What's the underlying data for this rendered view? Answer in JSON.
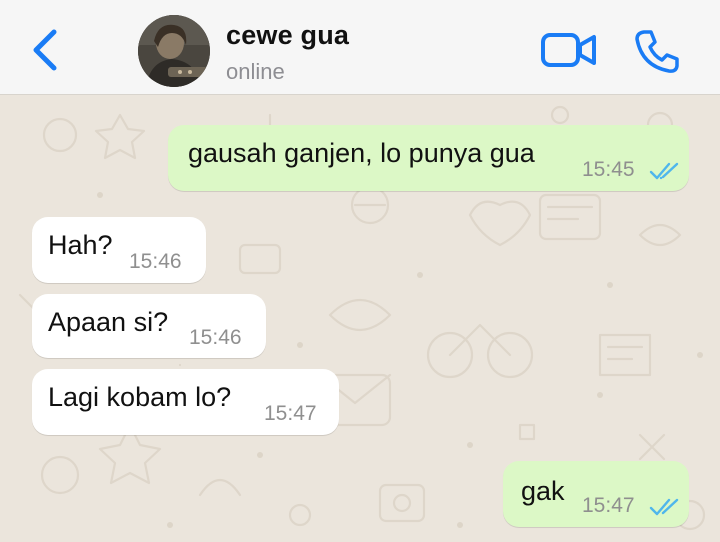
{
  "header": {
    "back_icon": "chevron-left-icon",
    "contact_name": "cewe gua",
    "contact_status": "online",
    "video_icon": "video-camera-icon",
    "call_icon": "phone-icon",
    "accent_color": "#1a7cf5"
  },
  "messages": [
    {
      "direction": "outgoing",
      "text": "gausah ganjen, lo punya gua",
      "time": "15:45",
      "status": "read"
    },
    {
      "direction": "incoming",
      "text": "Hah?",
      "time": "15:46"
    },
    {
      "direction": "incoming",
      "text": "Apaan si?",
      "time": "15:46"
    },
    {
      "direction": "incoming",
      "text": "Lagi kobam lo?",
      "time": "15:47"
    },
    {
      "direction": "outgoing",
      "text": "gak",
      "time": "15:47",
      "status": "read"
    }
  ],
  "colors": {
    "outgoing_bubble": "#dcf8c6",
    "incoming_bubble": "#ffffff",
    "read_ticks": "#4fb6ec",
    "wallpaper": "#ebe5dc"
  }
}
